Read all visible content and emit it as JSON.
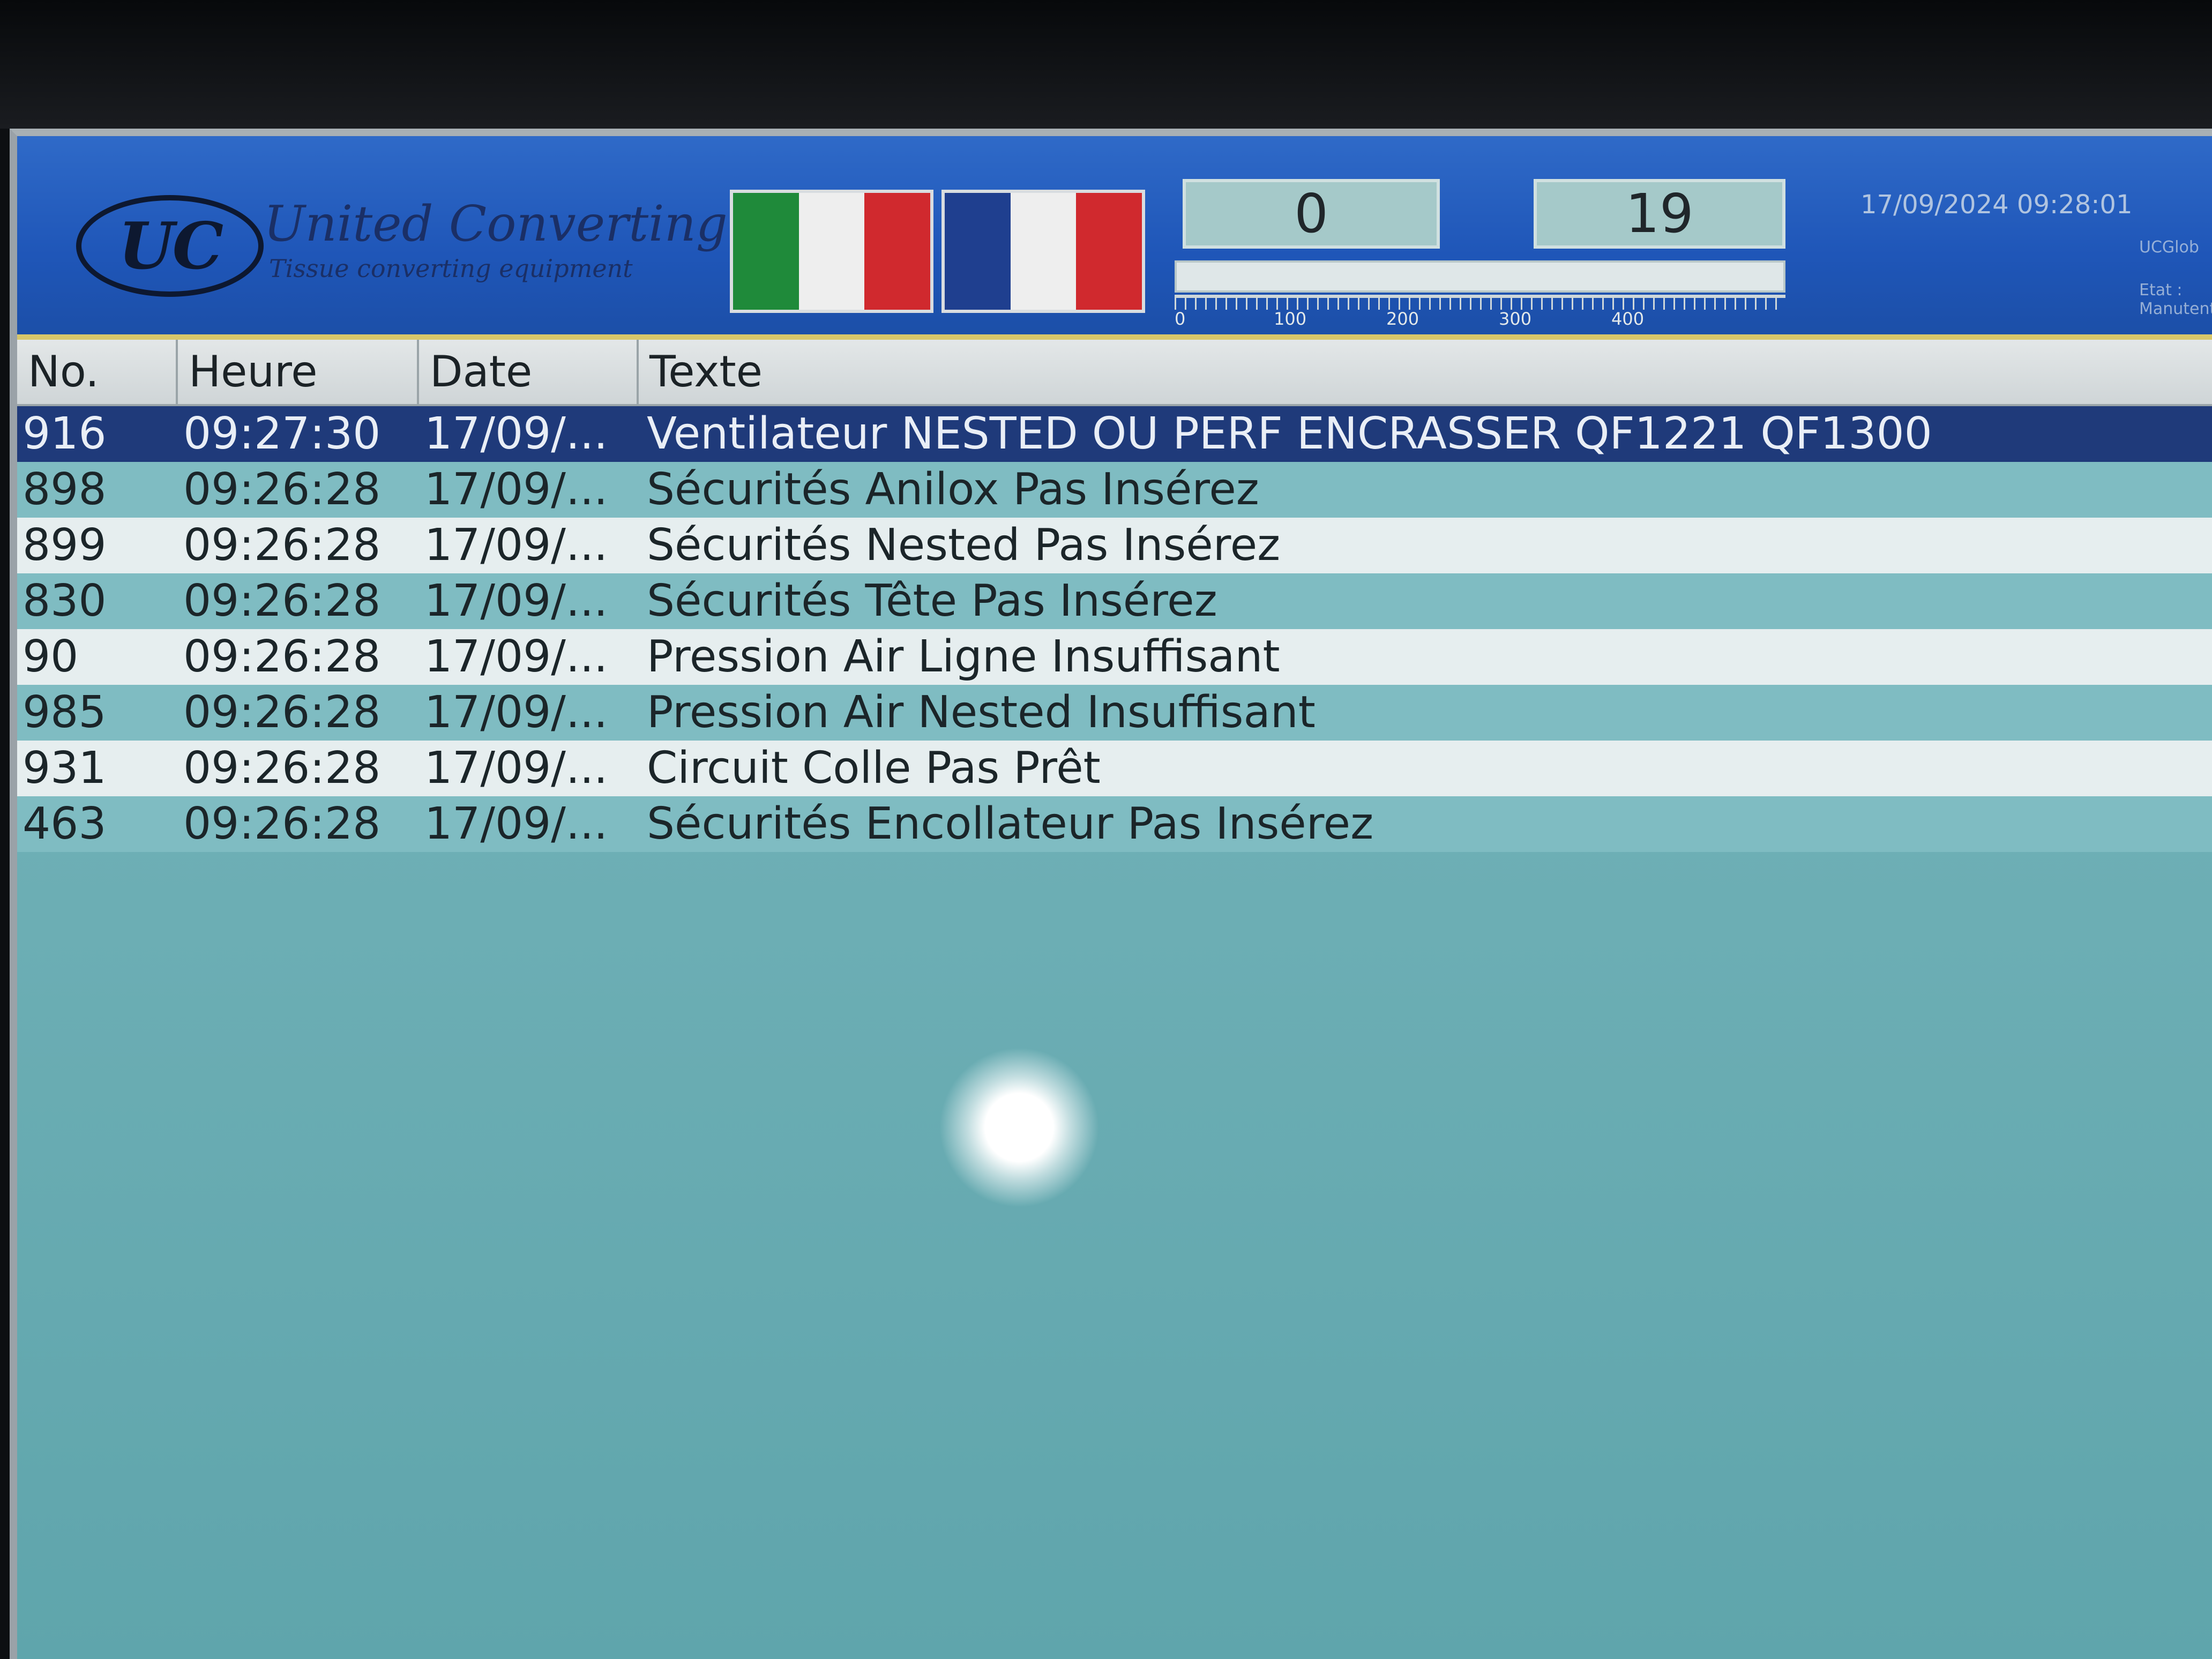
{
  "header": {
    "logo_text": "UC",
    "brand": "United Converting",
    "tagline": "Tissue converting equipment",
    "flags": [
      {
        "name": "italian-flag-icon",
        "colors": [
          "#1f8a3a",
          "#eeeeee",
          "#d0292e"
        ]
      },
      {
        "name": "french-flag-icon",
        "colors": [
          "#1f3f8f",
          "#eeeeee",
          "#d0292e"
        ]
      }
    ],
    "counter_left": "0",
    "counter_right": "19",
    "progress_fraction": 0.0,
    "scale_labels": [
      "0",
      "100",
      "200",
      "300",
      "400"
    ],
    "datetime": "17/09/2024 09:28:01",
    "side_label_top": "UCGlob",
    "side_label_bottom": "Etat : Manutenti"
  },
  "table": {
    "headers": {
      "no": "No.",
      "heure": "Heure",
      "date": "Date",
      "texte": "Texte"
    },
    "rows": [
      {
        "no": "916",
        "heure": "09:27:30",
        "date": "17/09/...",
        "texte": "Ventilateur NESTED OU PERF ENCRASSER QF1221 QF1300"
      },
      {
        "no": "898",
        "heure": "09:26:28",
        "date": "17/09/...",
        "texte": "Sécurités Anilox Pas Insérez"
      },
      {
        "no": "899",
        "heure": "09:26:28",
        "date": "17/09/...",
        "texte": "Sécurités Nested Pas Insérez"
      },
      {
        "no": "830",
        "heure": "09:26:28",
        "date": "17/09/...",
        "texte": "Sécurités Tête Pas Insérez"
      },
      {
        "no": "90",
        "heure": "09:26:28",
        "date": "17/09/...",
        "texte": "Pression Air Ligne Insuffisant"
      },
      {
        "no": "985",
        "heure": "09:26:28",
        "date": "17/09/...",
        "texte": "Pression Air Nested Insuffisant"
      },
      {
        "no": "931",
        "heure": "09:26:28",
        "date": "17/09/...",
        "texte": "Circuit Colle Pas Prêt"
      },
      {
        "no": "463",
        "heure": "09:26:28",
        "date": "17/09/...",
        "texte": "Sécurités Encollateur Pas Insérez"
      }
    ],
    "selected_index": 0
  }
}
